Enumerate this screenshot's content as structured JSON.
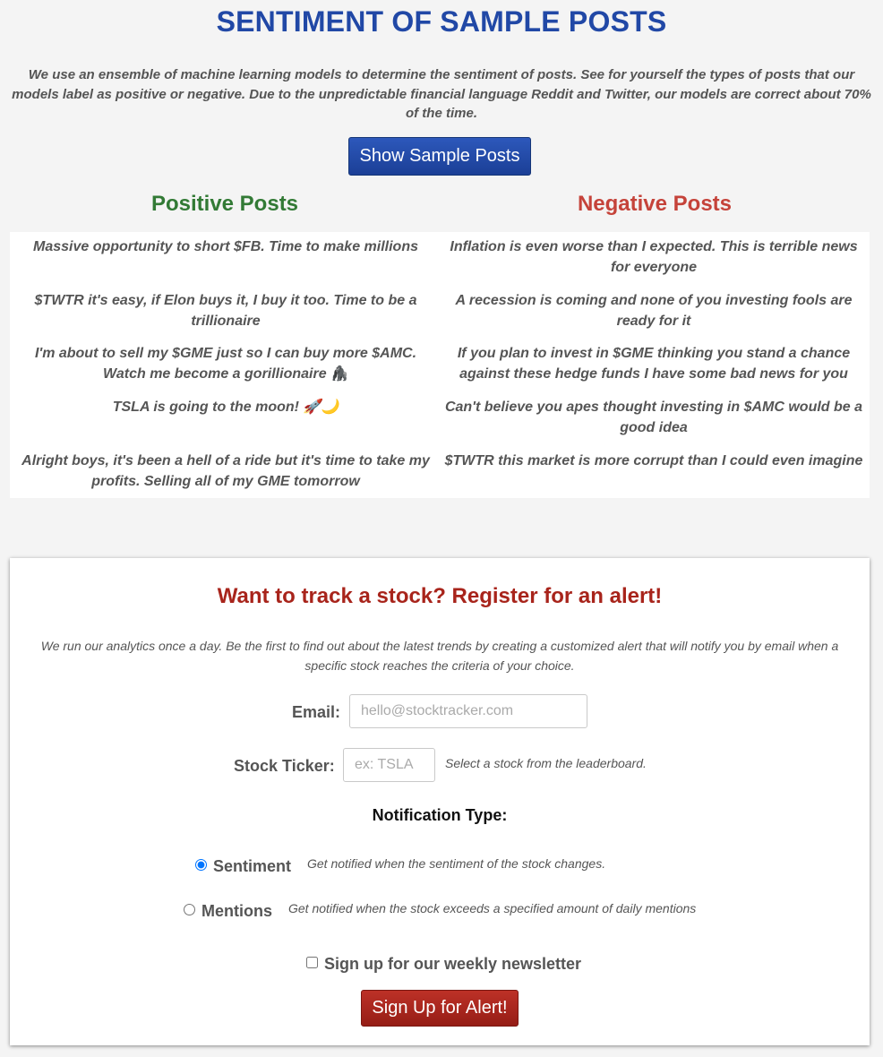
{
  "header": {
    "title": "SENTIMENT OF SAMPLE POSTS",
    "intro": "We use an ensemble of machine learning models to determine the sentiment of posts. See for yourself the types of posts that our models label as positive or negative. Due to the unpredictable financial language Reddit and Twitter, our models are correct about 70% of the time.",
    "show_button": "Show Sample Posts"
  },
  "posts": {
    "positive_heading": "Positive Posts",
    "negative_heading": "Negative Posts",
    "positive": [
      "Massive opportunity to short $FB. Time to make millions",
      "$TWTR it's easy, if Elon buys it, I buy it too. Time to be a trillionaire",
      "I'm about to sell my $GME just so I can buy more $AMC. Watch me become a gorillionaire 🦍",
      "TSLA is going to the moon! 🚀🌙",
      "Alright boys, it's been a hell of a ride but it's time to take my profits. Selling all of my GME tomorrow"
    ],
    "negative": [
      "Inflation is even worse than I expected. This is terrible news for everyone",
      "A recession is coming and none of you investing fools are ready for it",
      "If you plan to invest in $GME thinking you stand a chance against these hedge funds I have some bad news for you",
      "Can't believe you apes thought investing in $AMC would be a good idea",
      "$TWTR this market is more corrupt than I could even imagine"
    ]
  },
  "alert": {
    "title": "Want to track a stock? Register for an alert!",
    "description": "We run our analytics once a day. Be the first to find out about the latest trends by creating a customized alert that will notify you by email when a specific stock reaches the criteria of your choice.",
    "email_label": "Email:",
    "email_placeholder": "hello@stocktracker.com",
    "email_value": "",
    "ticker_label": "Stock Ticker:",
    "ticker_placeholder": "ex: TSLA",
    "ticker_value": "",
    "ticker_hint": "Select a stock from the leaderboard.",
    "notification_title": "Notification Type:",
    "sentiment_label": "Sentiment",
    "sentiment_hint": "Get notified when the sentiment of the stock changes.",
    "sentiment_selected": true,
    "mentions_label": "Mentions",
    "mentions_hint": "Get notified when the stock exceeds a specified amount of daily mentions",
    "mentions_selected": false,
    "newsletter_label": "Sign up for our weekly newsletter",
    "newsletter_checked": false,
    "submit_button": "Sign Up for Alert!"
  },
  "colors": {
    "page_title": "#2148a6",
    "positive": "#327a35",
    "negative": "#c5433a",
    "alert_title": "#a8241b",
    "primary_button": "#1f47a3",
    "submit_button": "#a8241b"
  }
}
